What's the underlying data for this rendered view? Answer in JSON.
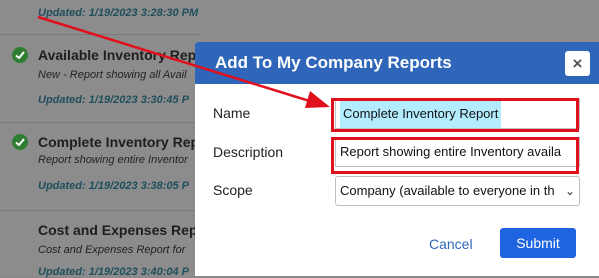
{
  "background_reports": [
    {
      "updated": "Updated:  1/19/2023 3:28:30 PM"
    },
    {
      "title": "Available Inventory Repor",
      "description": "New - Report showing all Avail",
      "updated": "Updated:  1/19/2023 3:30:45 P"
    },
    {
      "title": "Complete Inventory Repo",
      "description": "Report showing entire Inventor",
      "updated": "Updated:  1/19/2023 3:38:05 P"
    },
    {
      "title": "Cost and Expenses Repor",
      "description": "Cost and Expenses Report for",
      "updated": "Updated:  1/19/2023 3:40:04 P"
    }
  ],
  "modal": {
    "title": "Add To My Company Reports",
    "close_label": "×",
    "name_label": "Name",
    "name_value": "Complete Inventory Report",
    "description_label": "Description",
    "description_value": "Report showing entire Inventory availa",
    "scope_label": "Scope",
    "scope_value": "Company (available to everyone in th",
    "cancel_label": "Cancel",
    "submit_label": "Submit"
  },
  "colors": {
    "header": "#2f66ba",
    "submit": "#1e63e0",
    "highlight": "#b4ecff",
    "annotation_red": "#e0101c"
  }
}
